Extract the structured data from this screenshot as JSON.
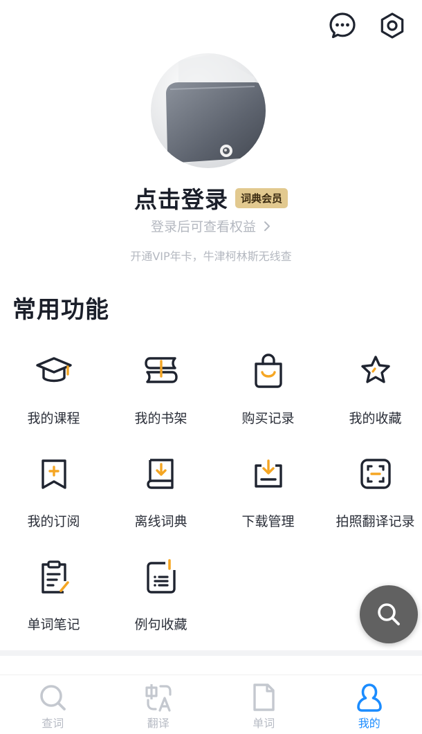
{
  "header": {
    "message_icon": "message-bubble-icon",
    "settings_icon": "settings-hex-icon"
  },
  "profile": {
    "login_title": "点击登录",
    "vip_badge": "词典会员",
    "subtitle": "登录后可查看权益",
    "promo": "开通VIP年卡，牛津柯林斯无线查"
  },
  "section": {
    "title": "常用功能"
  },
  "features": [
    {
      "label": "我的课程",
      "icon": "graduation-cap-icon"
    },
    {
      "label": "我的书架",
      "icon": "bookshelf-icon"
    },
    {
      "label": "购买记录",
      "icon": "shopping-bag-icon"
    },
    {
      "label": "我的收藏",
      "icon": "star-icon"
    },
    {
      "label": "我的订阅",
      "icon": "bookmark-plus-icon"
    },
    {
      "label": "离线词典",
      "icon": "offline-book-icon"
    },
    {
      "label": "下载管理",
      "icon": "download-tray-icon"
    },
    {
      "label": "拍照翻译记录",
      "icon": "scan-frame-icon"
    },
    {
      "label": "单词笔记",
      "icon": "note-pencil-icon"
    },
    {
      "label": "例句收藏",
      "icon": "sentence-note-icon"
    }
  ],
  "tabs": [
    {
      "label": "查词",
      "icon": "search-icon",
      "active": false
    },
    {
      "label": "翻译",
      "icon": "translate-icon",
      "active": false
    },
    {
      "label": "单词",
      "icon": "document-icon",
      "active": false
    },
    {
      "label": "我的",
      "icon": "user-icon",
      "active": true
    }
  ],
  "colors": {
    "accent_orange": "#f5a623",
    "active_blue": "#1b8cff",
    "icon_dark": "#1f2430",
    "vip_gold": "#e2c98f"
  }
}
